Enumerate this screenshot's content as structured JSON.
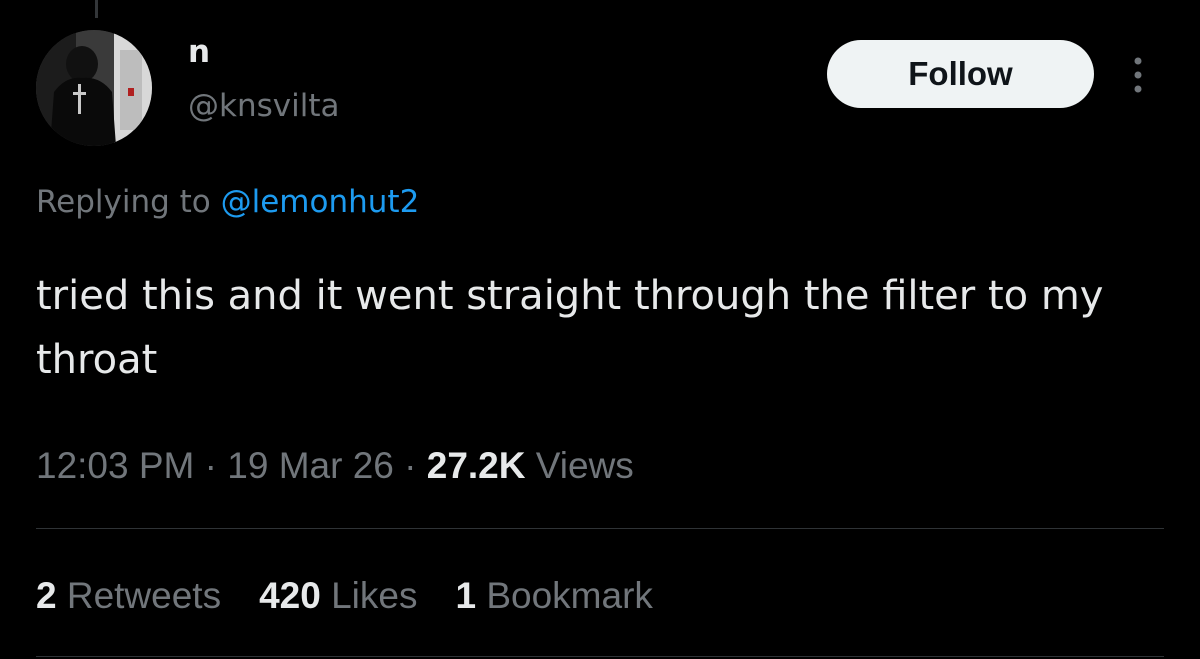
{
  "colors": {
    "background": "#000000",
    "primary_text": "#e7e9ea",
    "secondary_text": "#71767b",
    "link": "#1d9bf0",
    "follow_bg": "#eff3f4",
    "divider": "#2f3336"
  },
  "author": {
    "display_name": "n",
    "handle": "@knsvilta",
    "avatar_icon": "user-avatar-photo"
  },
  "header": {
    "follow_label": "Follow",
    "more_icon": "more-vertical-icon"
  },
  "reply": {
    "prefix": "Replying to ",
    "to_handle": "@lemonhut2"
  },
  "tweet": {
    "text": "tried this and it went straight through the filter to my throat"
  },
  "meta": {
    "time": "12:03 PM",
    "separator": " · ",
    "date": "19 Mar 26",
    "views_count": "27.2K",
    "views_label": " Views"
  },
  "stats": {
    "retweets_count": "2",
    "retweets_label": " Retweets",
    "likes_count": "420",
    "likes_label": " Likes",
    "bookmarks_count": "1",
    "bookmarks_label": " Bookmark"
  }
}
